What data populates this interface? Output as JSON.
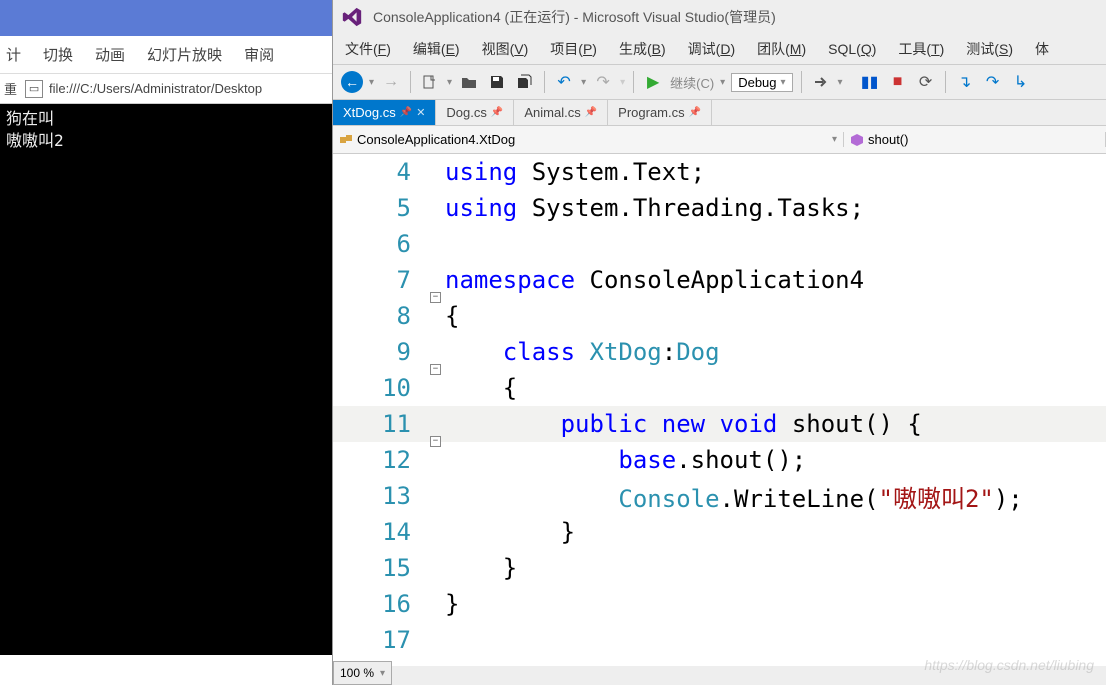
{
  "left": {
    "ribbon": [
      "计",
      "切换",
      "动画",
      "幻灯片放映",
      "审阅"
    ],
    "subbar_prefix": "重",
    "address": "file:///C:/Users/Administrator/Desktop",
    "console_lines": [
      "狗在叫",
      "嗷嗷叫2"
    ]
  },
  "vs": {
    "title": "ConsoleApplication4 (正在运行) - Microsoft Visual Studio(管理员)",
    "menu": [
      "文件(F)",
      "编辑(E)",
      "视图(V)",
      "项目(P)",
      "生成(B)",
      "调试(D)",
      "团队(M)",
      "SQL(Q)",
      "工具(T)",
      "测试(S)",
      "体"
    ],
    "toolbar": {
      "continue": "继续(C)",
      "config": "Debug"
    },
    "tabs": [
      {
        "name": "XtDog.cs",
        "active": true,
        "pinned": true
      },
      {
        "name": "Dog.cs",
        "active": false,
        "pinned": true
      },
      {
        "name": "Animal.cs",
        "active": false,
        "pinned": true
      },
      {
        "name": "Program.cs",
        "active": false,
        "pinned": true
      }
    ],
    "breadcrumb": {
      "namespace": "ConsoleApplication4.XtDog",
      "member": "shout()"
    },
    "code": [
      {
        "n": 4,
        "html": "<span class='kw'>using</span> <span class='plain'>System.Text;</span>"
      },
      {
        "n": 5,
        "html": "<span class='kw'>using</span> <span class='plain'>System.Threading.Tasks;</span>"
      },
      {
        "n": 6,
        "html": ""
      },
      {
        "n": 7,
        "html": "<span class='kw'>namespace</span> <span class='plain'>ConsoleApplication4</span>",
        "fold": "-"
      },
      {
        "n": 8,
        "html": "<span class='plain'>{</span>"
      },
      {
        "n": 9,
        "html": "    <span class='kw'>class</span> <span class='type'>XtDog</span><span class='plain'>:</span><span class='type'>Dog</span>",
        "fold": "-",
        "green": true
      },
      {
        "n": 10,
        "html": "    <span class='plain'>{</span>",
        "green": true
      },
      {
        "n": 11,
        "html": "        <span class='kw'>public</span> <span class='kw'>new</span> <span class='kw'>void</span> <span class='plain'>shout() {</span>",
        "fold": "-",
        "green": true,
        "hl": true
      },
      {
        "n": 12,
        "html": "            <span class='kw'>base</span><span class='plain'>.shout();</span>",
        "green": true
      },
      {
        "n": 13,
        "html": "            <span class='type'>Console</span><span class='plain'>.WriteLine(</span><span class='str'>\"嗷嗷叫2\"</span><span class='plain'>);</span>",
        "green": true
      },
      {
        "n": 14,
        "html": "        <span class='plain'>}</span>",
        "green": true
      },
      {
        "n": 15,
        "html": "    <span class='plain'>}</span>"
      },
      {
        "n": 16,
        "html": "<span class='plain'>}</span>"
      },
      {
        "n": 17,
        "html": ""
      }
    ],
    "zoom": "100 %"
  },
  "watermark": "https://blog.csdn.net/liubing"
}
